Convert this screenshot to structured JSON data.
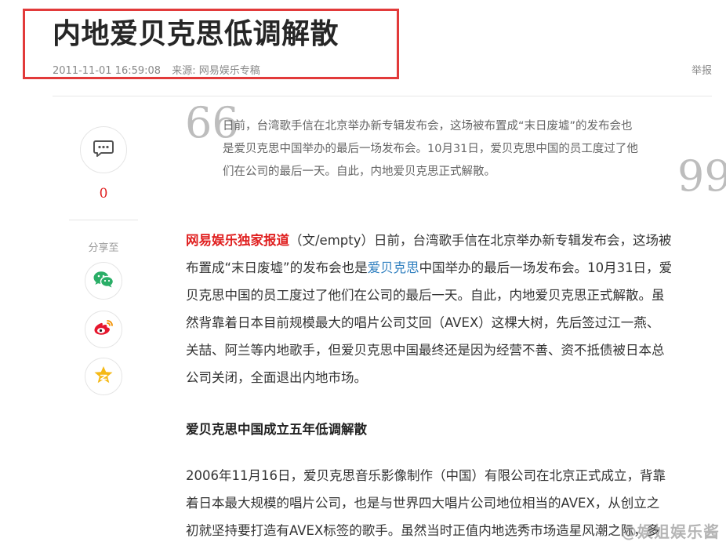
{
  "article": {
    "title": "内地爱贝克思低调解散",
    "datetime": "2011-11-01 16:59:08",
    "source_label": "来源: 网易娱乐专稿",
    "report_label": "举报"
  },
  "sidebar": {
    "comment_count": "0",
    "share_label": "分享至"
  },
  "summary": {
    "open_quote": "66",
    "close_quote": "99",
    "lines": [
      "日前，台湾歌手信在北京举办新专辑发布会，这场被布置成“末日废墟”的发布会也",
      "是爱贝克思中国举办的最后一场发布会。10月31日，爱贝克思中国的员工度过了他",
      "们在公司的最后一天。自此，内地爱贝克思正式解散。"
    ]
  },
  "body": {
    "para1": {
      "brand_tag": "网易娱乐独家报道",
      "line1_rest": "（文/empty）日前，台湾歌手信在北京举办新专辑发布会，这场被",
      "line2_pre": "布置成“末日废墟”的发布会也是",
      "line2_link": "爱贝克思",
      "line2_post": "中国举办的最后一场发布会。10月31日，爱",
      "line3": "贝克思中国的员工度过了他们在公司的最后一天。自此，内地爱贝克思正式解散。虽",
      "line4": "然背靠着日本目前规模最大的唱片公司艾回（AVEX）这棵大树，先后签过江一燕、",
      "line5": "关喆、阿兰等内地歌手，但爱贝克思中国最终还是因为经营不善、资不抵债被日本总",
      "line6": "公司关闭，全面退出内地市场。"
    },
    "subheading": "爱贝克思中国成立五年低调解散",
    "para3": {
      "line1": "2006年11月16日，爱贝克思音乐影像制作（中国）有限公司在北京正式成立，背靠",
      "line2": "着日本最大规模的唱片公司，也是与世界四大唱片公司地位相当的AVEX，从创立之",
      "line3": "初就坚持要打造有AVEX标签的歌手。虽然当时正值内地选秀市场造星风潮之际，多"
    }
  },
  "watermark": {
    "text": "@娱姐娱乐酱"
  },
  "colors": {
    "highlight_box": "#e23a3a",
    "brand_red": "#e02020",
    "link_blue": "#2f7fbf",
    "wechat_green": "#2aae67",
    "weibo_red": "#e6162d",
    "qzone_yellow": "#f5b916"
  },
  "icons": {
    "comment": "comment-bubble-icon",
    "wechat": "wechat-icon",
    "weibo": "weibo-icon",
    "qzone": "qzone-star-icon"
  }
}
